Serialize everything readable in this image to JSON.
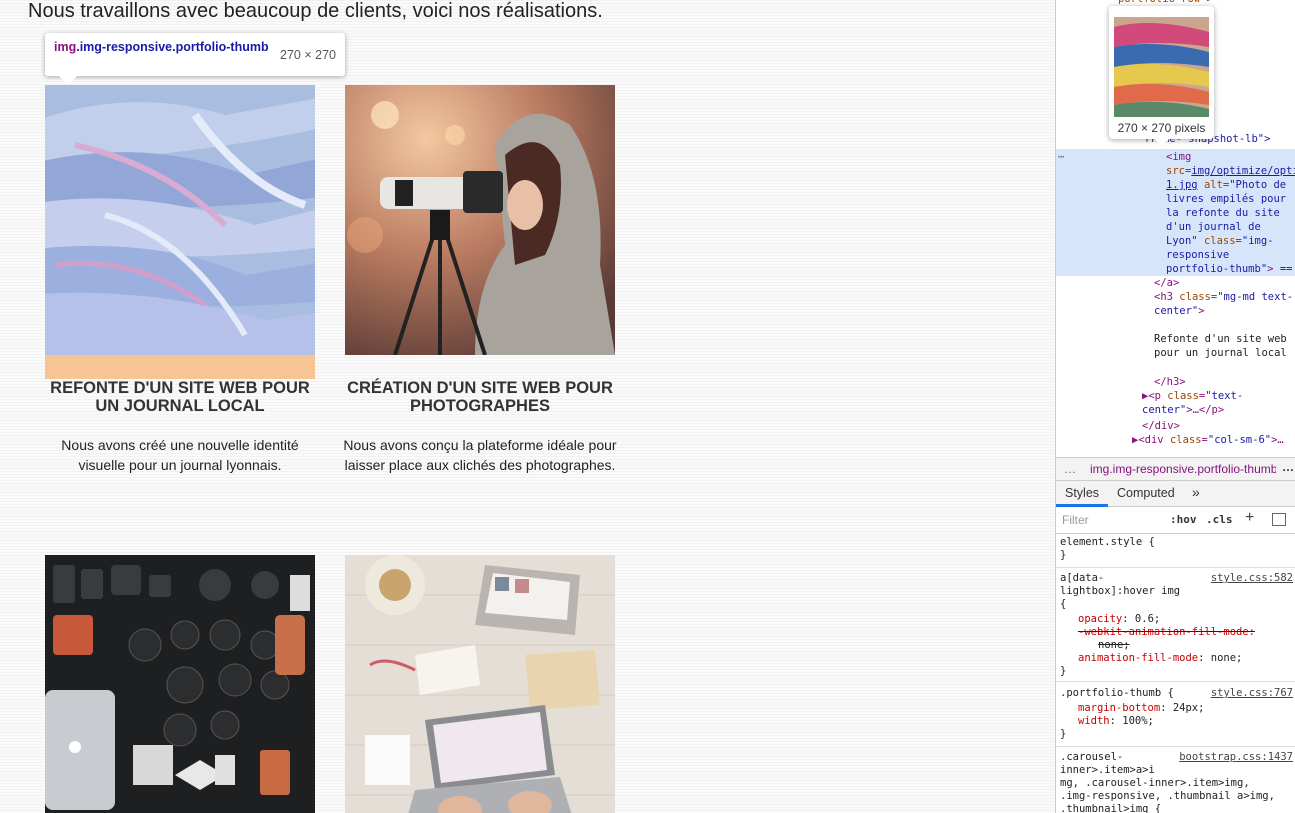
{
  "page": {
    "intro": "Nous travaillons avec beaucoup de clients, voici nos réalisations."
  },
  "tooltip": {
    "tag": "img",
    "classes": ".img-responsive.portfolio-thumb",
    "size": "270 × 270"
  },
  "portfolio": [
    {
      "title": "Refonte d'un site web pour un journal local",
      "description": "Nous avons créé une nouvelle identité visuelle pour un journal lyonnais."
    },
    {
      "title": "Création d'un site web pour photographes",
      "description": "Nous avons conçu la plateforme idéale pour laisser place aux clichés des photographes."
    }
  ],
  "devtools": {
    "preview_size": "270 × 270 pixels",
    "tree": {
      "row_class": "portfolio-row",
      "img_src": "img/optimize/optimized-1.jpg",
      "img_alt": "Photo de livres empilés pour la refonte du site d'un journal de Lyon",
      "img_class": "img-responsive portfolio-thumb",
      "h3_class": "mg-md text-center",
      "h3_text": "Refonte d'un site web pour un journal local",
      "p_class": "text-center",
      "div_class": "col-sm-6"
    },
    "breadcrumb": "img.img-responsive.portfolio-thumb",
    "tabs": [
      "Styles",
      "Computed"
    ],
    "filter_placeholder": "Filter",
    "hov": ":hov",
    "cls": ".cls",
    "rules": {
      "element_style": "element.style {",
      "hover_selector": "a[data-lightbox]:hover img",
      "hover_source": "style.css:582",
      "opacity_prop": "opacity",
      "opacity_val": "0.6;",
      "webkit_prop": "-webkit-animation-fill-mode:",
      "webkit_val": "none;",
      "afm_prop": "animation-fill-mode",
      "afm_val": "none;",
      "thumb_selector": ".portfolio-thumb",
      "thumb_source": "style.css:767",
      "mb_prop": "margin-bottom",
      "mb_val": "24px;",
      "w_prop": "width",
      "w_val": "100%;",
      "bs_source": "bootstrap.css:1437",
      "bs_sel1": ".carousel-",
      "bs_sel2": "inner>.item>a>i",
      "bs_sel3": "mg, .carousel-inner>.item>img,",
      "bs_sel4": ".img-responsive, .thumbnail a>img,",
      "bs_sel5": ".thumbnail>img {"
    }
  }
}
